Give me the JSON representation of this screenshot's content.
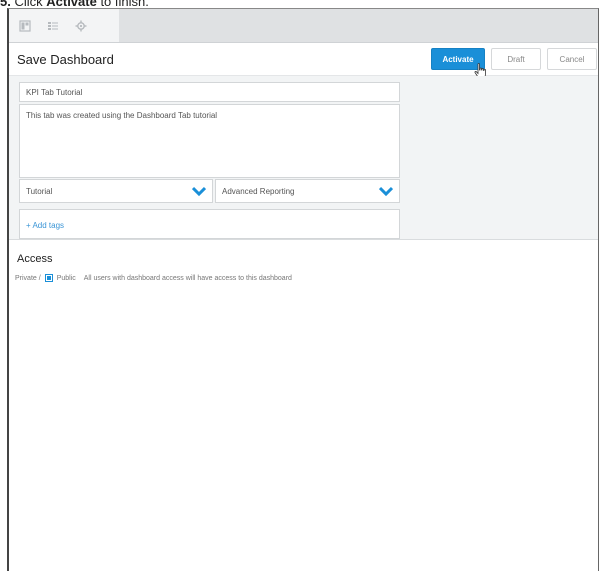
{
  "caption": {
    "step": "5.",
    "prefix": "Click ",
    "bold": "Activate",
    "suffix": " to finish."
  },
  "tabs": [
    {
      "icon": "dashboard-icon"
    },
    {
      "icon": "list-icon"
    },
    {
      "icon": "gear-icon"
    }
  ],
  "header": {
    "title": "Save Dashboard",
    "activate_label": "Activate",
    "draft_label": "Draft",
    "cancel_label": "Cancel"
  },
  "form": {
    "name_value": "KPI Tab Tutorial",
    "description_value": "This tab was created using the Dashboard Tab tutorial",
    "category_value": "Tutorial",
    "subcategory_value": "Advanced Reporting",
    "tags_label": "+ Add tags"
  },
  "access": {
    "heading": "Access",
    "private_label": "Private /",
    "public_label": "Public",
    "public_description": "All users with dashboard access will have access to this dashboard",
    "selected": "Public"
  },
  "colors": {
    "accent": "#1a8fd8",
    "form_bg": "#f2f4f5",
    "tabbar_bg": "#dfe1e3"
  }
}
